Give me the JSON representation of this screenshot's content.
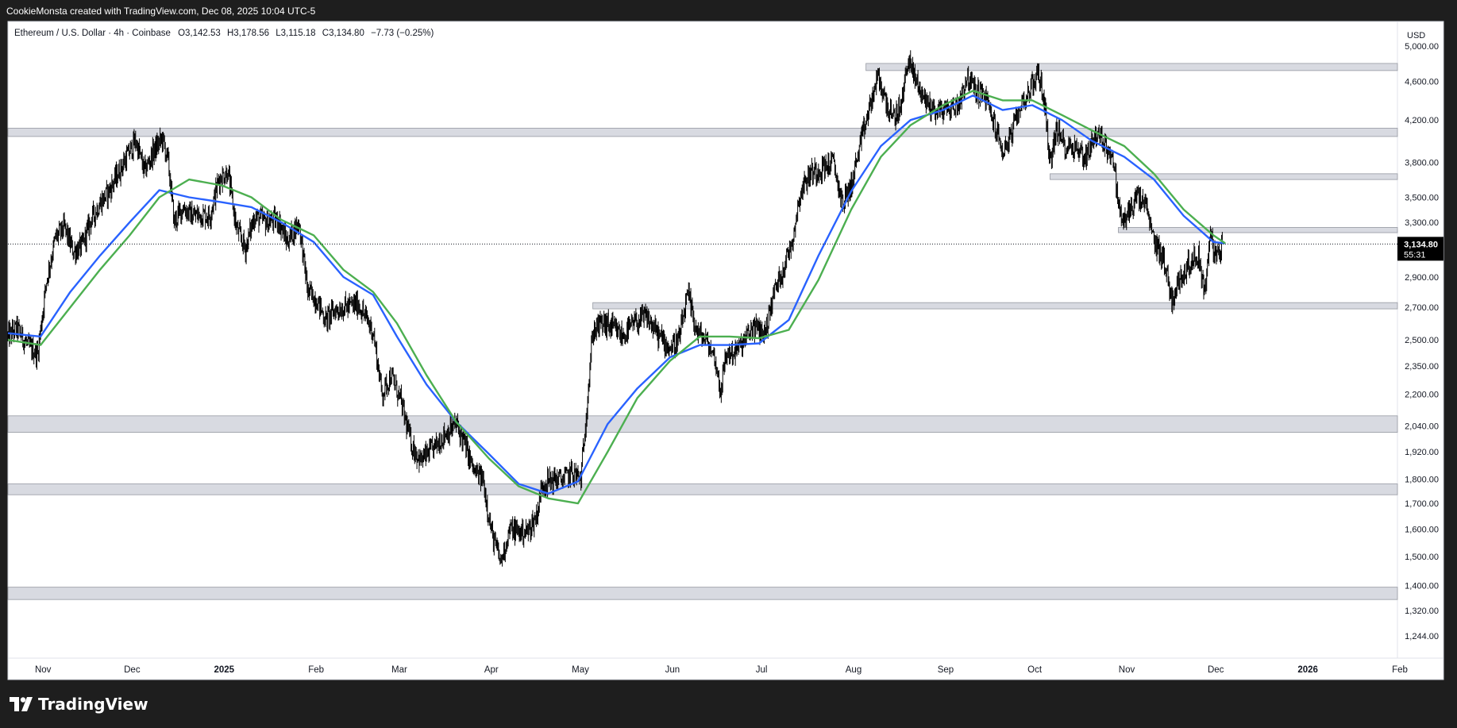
{
  "attribution": "CookieMonsta created with TradingView.com, Dec 08, 2025 10:04 UTC-5",
  "brand": {
    "name": "TradingView",
    "logo_icon": "tradingview-logo-icon"
  },
  "colors": {
    "background": "#1e1e1e",
    "panel": "#ffffff",
    "candles": "#000000",
    "ma_fast": "#2962ff",
    "ma_slow": "#4caf50",
    "zone_fill": "#d1d4dc",
    "last_price_label_bg": "#000000"
  },
  "chart_data": {
    "type": "candlestick",
    "symbol_info": {
      "name": "Ethereum / U.S. Dollar · 4h · Coinbase",
      "open": "O3,142.53",
      "high": "H3,178.56",
      "low": "L3,115.18",
      "close": "C3,134.80",
      "change": "−7.73 (−0.25%)"
    },
    "currency_label": "USD",
    "y_scale": "log",
    "y_range": [
      1180,
      5300
    ],
    "x_range": [
      "2024-10-25",
      "2026-02-05"
    ],
    "y_ticks": [
      {
        "value": 5000,
        "label": "5,000.00"
      },
      {
        "value": 4600,
        "label": "4,600.00"
      },
      {
        "value": 4200,
        "label": "4,200.00"
      },
      {
        "value": 3800,
        "label": "3,800.00"
      },
      {
        "value": 3500,
        "label": "3,500.00"
      },
      {
        "value": 3300,
        "label": "3,300.00"
      },
      {
        "value": 2900,
        "label": "2,900.00"
      },
      {
        "value": 2700,
        "label": "2,700.00"
      },
      {
        "value": 2500,
        "label": "2,500.00"
      },
      {
        "value": 2350,
        "label": "2,350.00"
      },
      {
        "value": 2200,
        "label": "2,200.00"
      },
      {
        "value": 2040,
        "label": "2,040.00"
      },
      {
        "value": 1920,
        "label": "1,920.00"
      },
      {
        "value": 1800,
        "label": "1,800.00"
      },
      {
        "value": 1700,
        "label": "1,700.00"
      },
      {
        "value": 1600,
        "label": "1,600.00"
      },
      {
        "value": 1500,
        "label": "1,500.00"
      },
      {
        "value": 1400,
        "label": "1,400.00"
      },
      {
        "value": 1320,
        "label": "1,320.00"
      },
      {
        "value": 1244,
        "label": "1,244.00"
      }
    ],
    "x_ticks": [
      {
        "date": "2024-11-01",
        "label": "Nov",
        "bold": false
      },
      {
        "date": "2024-12-01",
        "label": "Dec",
        "bold": false
      },
      {
        "date": "2025-01-01",
        "label": "2025",
        "bold": true
      },
      {
        "date": "2025-02-01",
        "label": "Feb",
        "bold": false
      },
      {
        "date": "2025-03-01",
        "label": "Mar",
        "bold": false
      },
      {
        "date": "2025-04-01",
        "label": "Apr",
        "bold": false
      },
      {
        "date": "2025-05-01",
        "label": "May",
        "bold": false
      },
      {
        "date": "2025-06-01",
        "label": "Jun",
        "bold": false
      },
      {
        "date": "2025-07-01",
        "label": "Jul",
        "bold": false
      },
      {
        "date": "2025-08-01",
        "label": "Aug",
        "bold": false
      },
      {
        "date": "2025-09-01",
        "label": "Sep",
        "bold": false
      },
      {
        "date": "2025-10-01",
        "label": "Oct",
        "bold": false
      },
      {
        "date": "2025-11-01",
        "label": "Nov",
        "bold": false
      },
      {
        "date": "2025-12-01",
        "label": "Dec",
        "bold": false
      },
      {
        "date": "2026-01-01",
        "label": "2026",
        "bold": true
      },
      {
        "date": "2026-02-01",
        "label": "Feb",
        "bold": false
      }
    ],
    "price_path": [
      [
        "2024-10-25",
        2520
      ],
      [
        "2024-10-28",
        2570
      ],
      [
        "2024-11-01",
        2460
      ],
      [
        "2024-11-04",
        2420
      ],
      [
        "2024-11-07",
        2880
      ],
      [
        "2024-11-10",
        3180
      ],
      [
        "2024-11-13",
        3260
      ],
      [
        "2024-11-16",
        3080
      ],
      [
        "2024-11-19",
        3120
      ],
      [
        "2024-11-22",
        3320
      ],
      [
        "2024-11-25",
        3450
      ],
      [
        "2024-11-28",
        3550
      ],
      [
        "2024-12-01",
        3700
      ],
      [
        "2024-12-04",
        3850
      ],
      [
        "2024-12-07",
        4000
      ],
      [
        "2024-12-10",
        3720
      ],
      [
        "2024-12-13",
        3900
      ],
      [
        "2024-12-16",
        4020
      ],
      [
        "2024-12-18",
        3800
      ],
      [
        "2024-12-20",
        3300
      ],
      [
        "2024-12-23",
        3420
      ],
      [
        "2024-12-26",
        3350
      ],
      [
        "2024-12-29",
        3360
      ],
      [
        "2025-01-01",
        3350
      ],
      [
        "2025-01-04",
        3650
      ],
      [
        "2025-01-07",
        3720
      ],
      [
        "2025-01-10",
        3250
      ],
      [
        "2025-01-13",
        3100
      ],
      [
        "2025-01-16",
        3350
      ],
      [
        "2025-01-20",
        3300
      ],
      [
        "2025-01-24",
        3320
      ],
      [
        "2025-01-27",
        3150
      ],
      [
        "2025-01-31",
        3300
      ],
      [
        "2025-02-03",
        2800
      ],
      [
        "2025-02-06",
        2750
      ],
      [
        "2025-02-09",
        2620
      ],
      [
        "2025-02-12",
        2680
      ],
      [
        "2025-02-15",
        2700
      ],
      [
        "2025-02-20",
        2720
      ],
      [
        "2025-02-25",
        2550
      ],
      [
        "2025-02-28",
        2200
      ],
      [
        "2025-03-03",
        2300
      ],
      [
        "2025-03-06",
        2180
      ],
      [
        "2025-03-10",
        1950
      ],
      [
        "2025-03-13",
        1880
      ],
      [
        "2025-03-17",
        1930
      ],
      [
        "2025-03-21",
        2000
      ],
      [
        "2025-03-25",
        2050
      ],
      [
        "2025-03-28",
        1950
      ],
      [
        "2025-03-31",
        1830
      ],
      [
        "2025-04-03",
        1800
      ],
      [
        "2025-04-06",
        1580
      ],
      [
        "2025-04-09",
        1480
      ],
      [
        "2025-04-12",
        1600
      ],
      [
        "2025-04-15",
        1590
      ],
      [
        "2025-04-18",
        1590
      ],
      [
        "2025-04-21",
        1650
      ],
      [
        "2025-04-23",
        1780
      ],
      [
        "2025-04-27",
        1800
      ],
      [
        "2025-04-30",
        1800
      ],
      [
        "2025-05-03",
        1830
      ],
      [
        "2025-05-06",
        1800
      ],
      [
        "2025-05-08",
        2150
      ],
      [
        "2025-05-10",
        2550
      ],
      [
        "2025-05-13",
        2600
      ],
      [
        "2025-05-16",
        2580
      ],
      [
        "2025-05-20",
        2520
      ],
      [
        "2025-05-24",
        2600
      ],
      [
        "2025-05-28",
        2640
      ],
      [
        "2025-06-01",
        2530
      ],
      [
        "2025-06-05",
        2450
      ],
      [
        "2025-06-08",
        2500
      ],
      [
        "2025-06-11",
        2780
      ],
      [
        "2025-06-14",
        2550
      ],
      [
        "2025-06-17",
        2500
      ],
      [
        "2025-06-20",
        2400
      ],
      [
        "2025-06-22",
        2220
      ],
      [
        "2025-06-24",
        2420
      ],
      [
        "2025-06-27",
        2430
      ],
      [
        "2025-06-30",
        2490
      ],
      [
        "2025-07-03",
        2580
      ],
      [
        "2025-07-07",
        2540
      ],
      [
        "2025-07-10",
        2800
      ],
      [
        "2025-07-13",
        2950
      ],
      [
        "2025-07-16",
        3150
      ],
      [
        "2025-07-19",
        3550
      ],
      [
        "2025-07-22",
        3700
      ],
      [
        "2025-07-26",
        3750
      ],
      [
        "2025-07-30",
        3800
      ],
      [
        "2025-08-02",
        3450
      ],
      [
        "2025-08-05",
        3600
      ],
      [
        "2025-08-08",
        3950
      ],
      [
        "2025-08-11",
        4300
      ],
      [
        "2025-08-14",
        4650
      ],
      [
        "2025-08-16",
        4450
      ],
      [
        "2025-08-19",
        4200
      ],
      [
        "2025-08-22",
        4350
      ],
      [
        "2025-08-24",
        4850
      ],
      [
        "2025-08-27",
        4600
      ],
      [
        "2025-08-30",
        4400
      ],
      [
        "2025-09-02",
        4300
      ],
      [
        "2025-09-06",
        4300
      ],
      [
        "2025-09-10",
        4350
      ],
      [
        "2025-09-13",
        4650
      ],
      [
        "2025-09-16",
        4500
      ],
      [
        "2025-09-19",
        4450
      ],
      [
        "2025-09-22",
        4180
      ],
      [
        "2025-09-25",
        3900
      ],
      [
        "2025-09-28",
        4050
      ],
      [
        "2025-10-01",
        4350
      ],
      [
        "2025-10-04",
        4500
      ],
      [
        "2025-10-07",
        4700
      ],
      [
        "2025-10-09",
        4400
      ],
      [
        "2025-10-11",
        3800
      ],
      [
        "2025-10-13",
        4100
      ],
      [
        "2025-10-16",
        3950
      ],
      [
        "2025-10-19",
        3950
      ],
      [
        "2025-10-23",
        3850
      ],
      [
        "2025-10-26",
        4050
      ],
      [
        "2025-10-29",
        4000
      ],
      [
        "2025-11-01",
        3850
      ],
      [
        "2025-11-04",
        3300
      ],
      [
        "2025-11-06",
        3350
      ],
      [
        "2025-11-09",
        3500
      ],
      [
        "2025-11-12",
        3450
      ],
      [
        "2025-11-15",
        3150
      ],
      [
        "2025-11-18",
        3050
      ],
      [
        "2025-11-21",
        2750
      ],
      [
        "2025-11-24",
        2900
      ],
      [
        "2025-11-27",
        3000
      ],
      [
        "2025-11-30",
        3050
      ],
      [
        "2025-12-02",
        2800
      ],
      [
        "2025-12-04",
        3200
      ],
      [
        "2025-12-06",
        3020
      ],
      [
        "2025-12-08",
        3134.8
      ]
    ],
    "moving_averages": [
      {
        "color": "#2962ff",
        "points": [
          [
            "2024-10-25",
            2540
          ],
          [
            "2024-11-05",
            2520
          ],
          [
            "2024-11-15",
            2800
          ],
          [
            "2024-11-25",
            3050
          ],
          [
            "2024-12-05",
            3300
          ],
          [
            "2024-12-15",
            3560
          ],
          [
            "2024-12-25",
            3500
          ],
          [
            "2025-01-05",
            3460
          ],
          [
            "2025-01-15",
            3420
          ],
          [
            "2025-01-25",
            3300
          ],
          [
            "2025-02-05",
            3150
          ],
          [
            "2025-02-15",
            2900
          ],
          [
            "2025-02-25",
            2780
          ],
          [
            "2025-03-05",
            2520
          ],
          [
            "2025-03-15",
            2250
          ],
          [
            "2025-03-25",
            2060
          ],
          [
            "2025-04-05",
            1910
          ],
          [
            "2025-04-15",
            1780
          ],
          [
            "2025-04-25",
            1740
          ],
          [
            "2025-05-05",
            1790
          ],
          [
            "2025-05-15",
            2050
          ],
          [
            "2025-05-25",
            2230
          ],
          [
            "2025-06-05",
            2400
          ],
          [
            "2025-06-15",
            2470
          ],
          [
            "2025-06-25",
            2470
          ],
          [
            "2025-07-05",
            2480
          ],
          [
            "2025-07-15",
            2620
          ],
          [
            "2025-07-25",
            3050
          ],
          [
            "2025-08-05",
            3550
          ],
          [
            "2025-08-15",
            3950
          ],
          [
            "2025-08-25",
            4200
          ],
          [
            "2025-09-05",
            4300
          ],
          [
            "2025-09-15",
            4450
          ],
          [
            "2025-09-25",
            4300
          ],
          [
            "2025-10-05",
            4350
          ],
          [
            "2025-10-15",
            4200
          ],
          [
            "2025-10-25",
            4000
          ],
          [
            "2025-11-05",
            3850
          ],
          [
            "2025-11-15",
            3650
          ],
          [
            "2025-11-25",
            3350
          ],
          [
            "2025-12-05",
            3150
          ],
          [
            "2025-12-09",
            3140
          ]
        ]
      },
      {
        "color": "#4caf50",
        "points": [
          [
            "2024-10-25",
            2500
          ],
          [
            "2024-11-05",
            2470
          ],
          [
            "2024-11-15",
            2700
          ],
          [
            "2024-11-25",
            2950
          ],
          [
            "2024-12-05",
            3200
          ],
          [
            "2024-12-15",
            3500
          ],
          [
            "2024-12-25",
            3650
          ],
          [
            "2025-01-05",
            3600
          ],
          [
            "2025-01-15",
            3500
          ],
          [
            "2025-01-25",
            3320
          ],
          [
            "2025-02-05",
            3200
          ],
          [
            "2025-02-15",
            2950
          ],
          [
            "2025-02-25",
            2800
          ],
          [
            "2025-03-05",
            2600
          ],
          [
            "2025-03-15",
            2300
          ],
          [
            "2025-03-25",
            2060
          ],
          [
            "2025-04-05",
            1890
          ],
          [
            "2025-04-15",
            1770
          ],
          [
            "2025-04-25",
            1720
          ],
          [
            "2025-05-05",
            1700
          ],
          [
            "2025-05-15",
            1920
          ],
          [
            "2025-05-25",
            2180
          ],
          [
            "2025-06-05",
            2380
          ],
          [
            "2025-06-15",
            2520
          ],
          [
            "2025-06-25",
            2520
          ],
          [
            "2025-07-05",
            2510
          ],
          [
            "2025-07-15",
            2560
          ],
          [
            "2025-07-25",
            2880
          ],
          [
            "2025-08-05",
            3400
          ],
          [
            "2025-08-15",
            3850
          ],
          [
            "2025-08-25",
            4150
          ],
          [
            "2025-09-05",
            4350
          ],
          [
            "2025-09-15",
            4500
          ],
          [
            "2025-09-25",
            4400
          ],
          [
            "2025-10-05",
            4400
          ],
          [
            "2025-10-15",
            4250
          ],
          [
            "2025-10-25",
            4100
          ],
          [
            "2025-11-05",
            3950
          ],
          [
            "2025-11-15",
            3700
          ],
          [
            "2025-11-25",
            3400
          ],
          [
            "2025-12-05",
            3200
          ],
          [
            "2025-12-09",
            3140
          ]
        ]
      }
    ],
    "zones": [
      {
        "from": "2025-08-10",
        "low": 4720,
        "high": 4800
      },
      {
        "from": "2024-10-25",
        "low": 4040,
        "high": 4120
      },
      {
        "from": "2025-10-11",
        "low": 3650,
        "high": 3700
      },
      {
        "from": "2025-11-03",
        "low": 3220,
        "high": 3260
      },
      {
        "from": "2025-05-10",
        "low": 2690,
        "high": 2730
      },
      {
        "from": "2024-10-25",
        "low": 2010,
        "high": 2090
      },
      {
        "from": "2024-10-25",
        "low": 1735,
        "high": 1780
      },
      {
        "from": "2024-10-25",
        "low": 1355,
        "high": 1395
      }
    ],
    "last_price": {
      "value": 3134.8,
      "label": "3,134.80",
      "countdown": "55:31"
    }
  }
}
